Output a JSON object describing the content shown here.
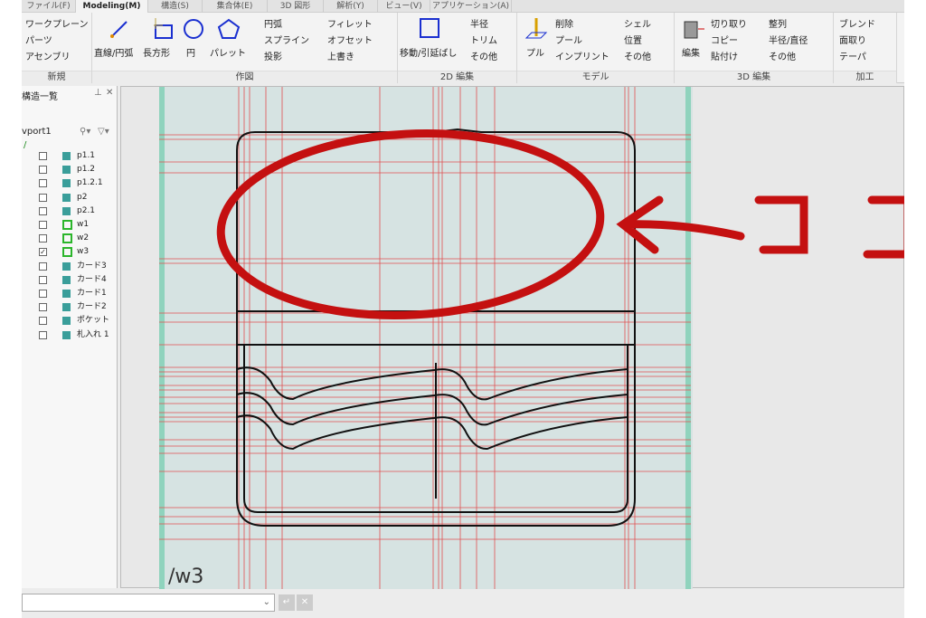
{
  "tabs": [
    "ファイル(F)",
    "Modeling(M)",
    "構造(S)",
    "集合体(E)",
    "3D 図形",
    "解析(Y)",
    "ビュー(V)",
    "アプリケーション(A)"
  ],
  "groups": {
    "new": {
      "label": "新規",
      "items": [
        "ワークプレーン",
        "パーツ",
        "アセンブリ"
      ]
    },
    "draw": {
      "label": "作図",
      "big": [
        "直線/円弧",
        "長方形",
        "円",
        "パレット"
      ],
      "items": [
        "円弧",
        "スプライン",
        "投影",
        "フィレット",
        "オフセット",
        "上書き"
      ]
    },
    "edit2d": {
      "label": "2D 編集",
      "big": "移動/引延ばし",
      "items": [
        "半径",
        "トリム",
        "その他"
      ]
    },
    "model": {
      "label": "モデル",
      "big": "プル",
      "items": [
        "削除",
        "プール",
        "インプリント",
        "シェル",
        "位置",
        "その他"
      ]
    },
    "edit3d": {
      "label": "3D 編集",
      "big": "編集",
      "items": [
        "切り取り",
        "コピー",
        "貼付け",
        "整列",
        "半径/直径",
        "その他"
      ]
    },
    "machining": {
      "label": "加工",
      "items": [
        "ブレンド",
        "面取り",
        "テーパ"
      ]
    }
  },
  "panel": {
    "title": "構造一覧",
    "viewport": "vport1",
    "items": [
      {
        "label": "p1.1",
        "type": "solid",
        "checked": false
      },
      {
        "label": "p1.2",
        "type": "solid",
        "checked": false
      },
      {
        "label": "p1.2.1",
        "type": "solid",
        "checked": false
      },
      {
        "label": "p2",
        "type": "solid",
        "checked": false
      },
      {
        "label": "p2.1",
        "type": "solid",
        "checked": false
      },
      {
        "label": "w1",
        "type": "workplane",
        "checked": false
      },
      {
        "label": "w2",
        "type": "workplane",
        "checked": false
      },
      {
        "label": "w3",
        "type": "workplane",
        "checked": true
      },
      {
        "label": "カード3",
        "type": "solid",
        "checked": false
      },
      {
        "label": "カード4",
        "type": "solid",
        "checked": false
      },
      {
        "label": "カード1",
        "type": "solid",
        "checked": false
      },
      {
        "label": "カード2",
        "type": "solid",
        "checked": false
      },
      {
        "label": "ポケット",
        "type": "solid",
        "checked": false
      },
      {
        "label": "札入れ 1",
        "type": "solid",
        "checked": false
      }
    ]
  },
  "viewport": {
    "workplane_label": "/w3"
  },
  "annotation": {
    "text": "ココ",
    "color": "#c41010"
  },
  "colors": {
    "accent": "#2bb52b",
    "grid": "#e05050",
    "plane": "#d6e3e2"
  }
}
